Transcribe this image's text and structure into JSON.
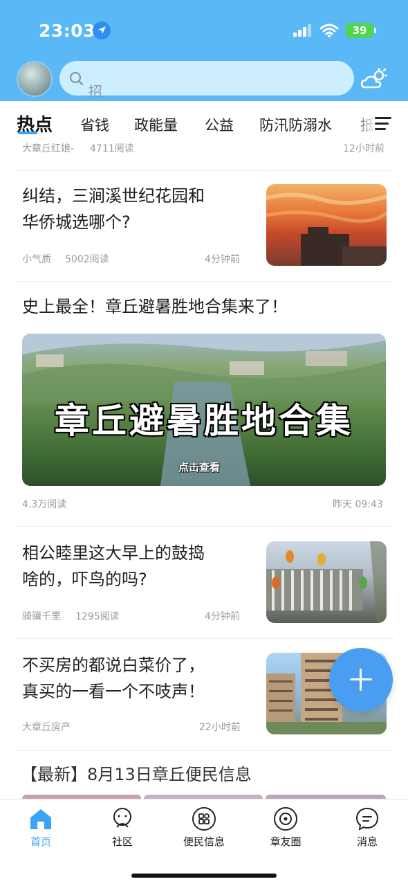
{
  "status": {
    "time": "23:03",
    "battery": "39"
  },
  "search": {
    "placeholder": "招"
  },
  "tabs": [
    "热点",
    "省钱",
    "政能量",
    "公益",
    "防汛防溺水",
    "抵"
  ],
  "feed": {
    "partial_item": {
      "author": "大章丘红娘-",
      "reads": "4711阅读",
      "time": "12小时前"
    },
    "items": [
      {
        "title_line1": "纠结，三涧溪世纪花园和",
        "title_line2": "华侨城选哪个?",
        "author": "小气质",
        "reads": "5002阅读",
        "time": "4分钟前",
        "thumb": "sunset-building"
      },
      {
        "title": "史上最全！章丘避暑胜地合集来了！",
        "image_caption": "章丘避暑胜地合集",
        "image_sub": "点击查看",
        "reads": "4.3万阅读",
        "time": "昨天 09:43"
      },
      {
        "title_line1": "相公睦里这大早上的鼓捣",
        "title_line2": "啥的，吓鸟的吗?",
        "author": "骑骥千里",
        "reads": "1295阅读",
        "time": "4分钟前",
        "thumb": "lanterns"
      },
      {
        "title_line1": "不买房的都说白菜价了，",
        "title_line2": "真买的一看一个不吱声！",
        "author": "大章丘房产",
        "reads": "",
        "time": "22小时前",
        "thumb": "high-rise"
      }
    ],
    "partial_bottom_title": "【最新】8月13日章丘便民信息"
  },
  "bottom_nav": [
    {
      "label": "首页",
      "icon": "home-icon",
      "active": true
    },
    {
      "label": "社区",
      "icon": "community-icon",
      "active": false
    },
    {
      "label": "便民信息",
      "icon": "grid-icon",
      "active": false
    },
    {
      "label": "章友圈",
      "icon": "circle-icon",
      "active": false
    },
    {
      "label": "消息",
      "icon": "message-icon",
      "active": false
    }
  ],
  "colors": {
    "header": "#5ab8f7",
    "accent": "#3da4f5",
    "fab": "#4a9ef2"
  }
}
